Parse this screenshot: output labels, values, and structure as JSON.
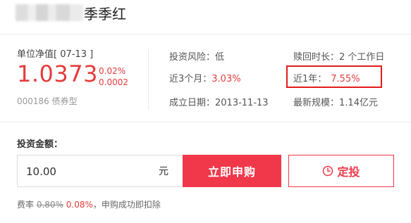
{
  "header": {
    "fund_name": "季季红"
  },
  "nav": {
    "label": "单位净值[ 07-13 ]",
    "value": "1.0373",
    "change_pct": "0.02%",
    "change_abs": "0.0002",
    "code_type": "000186 债券型"
  },
  "info": {
    "risk_label": "投资风险：",
    "risk_value": "低",
    "redeem_label": "赎回时长：",
    "redeem_value": "2 个工作日",
    "m3_label": "近3个月：",
    "m3_value": "3.03%",
    "y1_label": "近1年：",
    "y1_value": "7.55%",
    "inception_label": "成立日期：",
    "inception_value": "2013-11-13",
    "size_label": "最新规模：",
    "size_value": "1.14亿元"
  },
  "invest": {
    "label": "投资金额：",
    "amount_value": "10.00",
    "unit": "元",
    "buy_label": "立即申购",
    "sip_label": "定投"
  },
  "fee": {
    "label": "费率",
    "original": "0.80%",
    "discounted": "0.08%",
    "note": "，申购成功即扣除"
  },
  "colors": {
    "accent": "#f0384a",
    "highlight": "#e21c1c"
  }
}
